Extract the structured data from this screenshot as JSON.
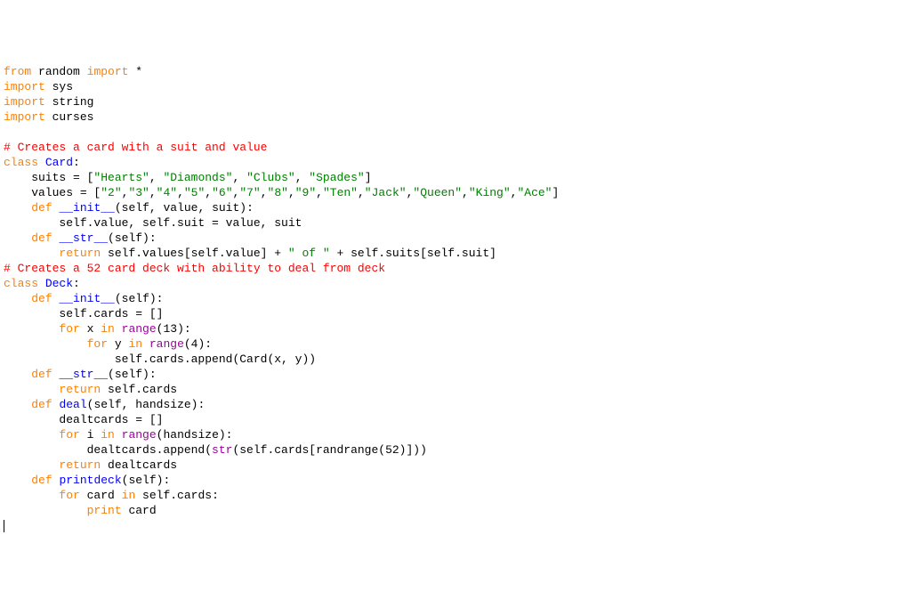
{
  "colors": {
    "orange": "#ff8000",
    "green": "#008000",
    "blue": "#0000ff",
    "red": "#ff0000",
    "purple": "#a000a0",
    "black": "#000000"
  },
  "lines": [
    [
      [
        "orange",
        "from"
      ],
      [
        "black",
        " random "
      ],
      [
        "orange",
        "import"
      ],
      [
        "black",
        " *"
      ]
    ],
    [
      [
        "orange",
        "import"
      ],
      [
        "black",
        " sys"
      ]
    ],
    [
      [
        "orange",
        "import"
      ],
      [
        "black",
        " string"
      ]
    ],
    [
      [
        "orange",
        "import"
      ],
      [
        "black",
        " curses"
      ]
    ],
    [],
    [
      [
        "red",
        "# Creates a card with a suit and value"
      ]
    ],
    [
      [
        "orange",
        "class"
      ],
      [
        "black",
        " "
      ],
      [
        "blue",
        "Card"
      ],
      [
        "black",
        ":"
      ]
    ],
    [
      [
        "black",
        "    suits = ["
      ],
      [
        "green",
        "\"Hearts\""
      ],
      [
        "black",
        ", "
      ],
      [
        "green",
        "\"Diamonds\""
      ],
      [
        "black",
        ", "
      ],
      [
        "green",
        "\"Clubs\""
      ],
      [
        "black",
        ", "
      ],
      [
        "green",
        "\"Spades\""
      ],
      [
        "black",
        "]"
      ]
    ],
    [
      [
        "black",
        "    values = ["
      ],
      [
        "green",
        "\"2\""
      ],
      [
        "black",
        ","
      ],
      [
        "green",
        "\"3\""
      ],
      [
        "black",
        ","
      ],
      [
        "green",
        "\"4\""
      ],
      [
        "black",
        ","
      ],
      [
        "green",
        "\"5\""
      ],
      [
        "black",
        ","
      ],
      [
        "green",
        "\"6\""
      ],
      [
        "black",
        ","
      ],
      [
        "green",
        "\"7\""
      ],
      [
        "black",
        ","
      ],
      [
        "green",
        "\"8\""
      ],
      [
        "black",
        ","
      ],
      [
        "green",
        "\"9\""
      ],
      [
        "black",
        ","
      ],
      [
        "green",
        "\"Ten\""
      ],
      [
        "black",
        ","
      ],
      [
        "green",
        "\"Jack\""
      ],
      [
        "black",
        ","
      ],
      [
        "green",
        "\"Queen\""
      ],
      [
        "black",
        ","
      ],
      [
        "green",
        "\"King\""
      ],
      [
        "black",
        ","
      ],
      [
        "green",
        "\"Ace\""
      ],
      [
        "black",
        "]"
      ]
    ],
    [
      [
        "black",
        "    "
      ],
      [
        "orange",
        "def"
      ],
      [
        "black",
        " "
      ],
      [
        "blue",
        "__init__"
      ],
      [
        "black",
        "(self, value, suit):"
      ]
    ],
    [
      [
        "black",
        "        self.value, self.suit = value, suit"
      ]
    ],
    [
      [
        "black",
        "    "
      ],
      [
        "orange",
        "def"
      ],
      [
        "black",
        " "
      ],
      [
        "blue",
        "__str__"
      ],
      [
        "black",
        "(self):"
      ]
    ],
    [
      [
        "black",
        "        "
      ],
      [
        "orange",
        "return"
      ],
      [
        "black",
        " self.values[self.value] + "
      ],
      [
        "green",
        "\" of \""
      ],
      [
        "black",
        " + self.suits[self.suit]"
      ]
    ],
    [
      [
        "red",
        "# Creates a 52 card deck with ability to deal from deck"
      ]
    ],
    [
      [
        "orange",
        "class"
      ],
      [
        "black",
        " "
      ],
      [
        "blue",
        "Deck"
      ],
      [
        "black",
        ":"
      ]
    ],
    [
      [
        "black",
        "    "
      ],
      [
        "orange",
        "def"
      ],
      [
        "black",
        " "
      ],
      [
        "blue",
        "__init__"
      ],
      [
        "black",
        "(self):"
      ]
    ],
    [
      [
        "black",
        "        self.cards = []"
      ]
    ],
    [
      [
        "black",
        "        "
      ],
      [
        "orange",
        "for"
      ],
      [
        "black",
        " x "
      ],
      [
        "orange",
        "in"
      ],
      [
        "black",
        " "
      ],
      [
        "purple",
        "range"
      ],
      [
        "black",
        "(13):"
      ]
    ],
    [
      [
        "black",
        "            "
      ],
      [
        "orange",
        "for"
      ],
      [
        "black",
        " y "
      ],
      [
        "orange",
        "in"
      ],
      [
        "black",
        " "
      ],
      [
        "purple",
        "range"
      ],
      [
        "black",
        "(4):"
      ]
    ],
    [
      [
        "black",
        "                self.cards.append(Card(x, y))"
      ]
    ],
    [
      [
        "black",
        "    "
      ],
      [
        "orange",
        "def"
      ],
      [
        "black",
        " "
      ],
      [
        "blue",
        "__str__"
      ],
      [
        "black",
        "(self):"
      ]
    ],
    [
      [
        "black",
        "        "
      ],
      [
        "orange",
        "return"
      ],
      [
        "black",
        " self.cards"
      ]
    ],
    [
      [
        "black",
        "    "
      ],
      [
        "orange",
        "def"
      ],
      [
        "black",
        " "
      ],
      [
        "blue",
        "deal"
      ],
      [
        "black",
        "(self, handsize):"
      ]
    ],
    [
      [
        "black",
        "        dealtcards = []"
      ]
    ],
    [
      [
        "black",
        "        "
      ],
      [
        "orange",
        "for"
      ],
      [
        "black",
        " i "
      ],
      [
        "orange",
        "in"
      ],
      [
        "black",
        " "
      ],
      [
        "purple",
        "range"
      ],
      [
        "black",
        "(handsize):"
      ]
    ],
    [
      [
        "black",
        "            dealtcards.append("
      ],
      [
        "purple",
        "str"
      ],
      [
        "black",
        "(self.cards[randrange(52)]))"
      ]
    ],
    [
      [
        "black",
        "        "
      ],
      [
        "orange",
        "return"
      ],
      [
        "black",
        " dealtcards"
      ]
    ],
    [
      [
        "black",
        "    "
      ],
      [
        "orange",
        "def"
      ],
      [
        "black",
        " "
      ],
      [
        "blue",
        "printdeck"
      ],
      [
        "black",
        "(self):"
      ]
    ],
    [
      [
        "black",
        "        "
      ],
      [
        "orange",
        "for"
      ],
      [
        "black",
        " card "
      ],
      [
        "orange",
        "in"
      ],
      [
        "black",
        " self.cards:"
      ]
    ],
    [
      [
        "black",
        "            "
      ],
      [
        "orange",
        "print"
      ],
      [
        "black",
        " card"
      ]
    ]
  ]
}
